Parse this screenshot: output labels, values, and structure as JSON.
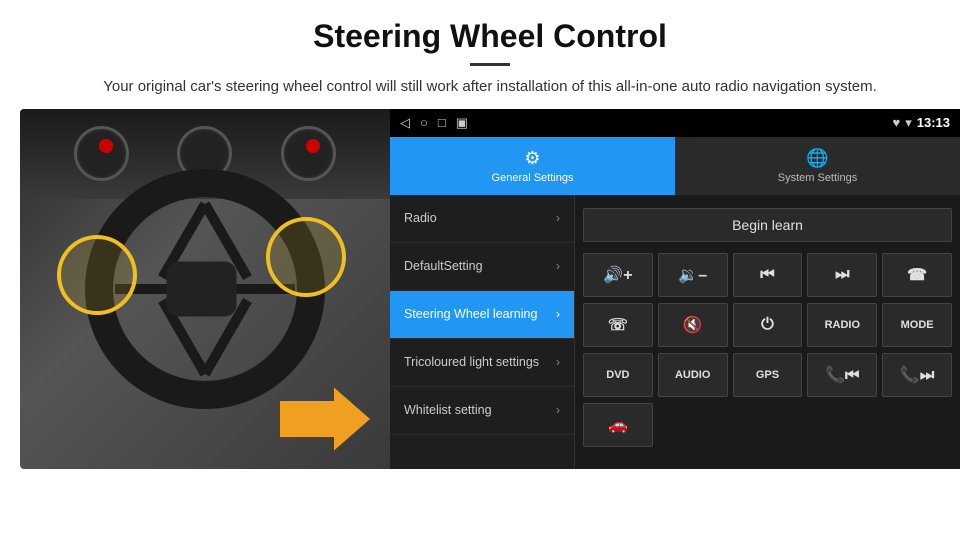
{
  "header": {
    "title": "Steering Wheel Control",
    "subtitle": "Your original car's steering wheel control will still work after installation of this all-in-one auto radio navigation system."
  },
  "status_bar": {
    "icons": [
      "◁",
      "○",
      "□",
      "▣"
    ],
    "right_icons": [
      "♥",
      "▾"
    ],
    "time": "13:13"
  },
  "tabs": [
    {
      "id": "general",
      "label": "General Settings",
      "icon": "⚙",
      "active": true
    },
    {
      "id": "system",
      "label": "System Settings",
      "icon": "🌐",
      "active": false
    }
  ],
  "menu_items": [
    {
      "id": "radio",
      "label": "Radio",
      "active": false
    },
    {
      "id": "default-setting",
      "label": "DefaultSetting",
      "active": false
    },
    {
      "id": "steering-wheel",
      "label": "Steering Wheel learning",
      "active": true
    },
    {
      "id": "tricoloured",
      "label": "Tricoloured light settings",
      "active": false
    },
    {
      "id": "whitelist",
      "label": "Whitelist setting",
      "active": false
    }
  ],
  "control_panel": {
    "begin_learn_label": "Begin learn",
    "buttons_row1": [
      {
        "id": "vol-up",
        "symbol": "🔊+",
        "label": "vol-up"
      },
      {
        "id": "vol-down",
        "symbol": "🔈-",
        "label": "vol-down"
      },
      {
        "id": "prev-track",
        "symbol": "⏮",
        "label": "prev-track"
      },
      {
        "id": "next-track",
        "symbol": "⏭",
        "label": "next-track"
      },
      {
        "id": "phone",
        "symbol": "☎",
        "label": "phone"
      }
    ],
    "buttons_row2": [
      {
        "id": "hang-up",
        "symbol": "☏",
        "label": "hang-up"
      },
      {
        "id": "mute",
        "symbol": "🔇",
        "label": "mute"
      },
      {
        "id": "power",
        "symbol": "⏻",
        "label": "power"
      },
      {
        "id": "radio-btn",
        "symbol": "RADIO",
        "label": "radio",
        "is_text": true
      },
      {
        "id": "mode-btn",
        "symbol": "MODE",
        "label": "mode",
        "is_text": true
      }
    ],
    "buttons_row3": [
      {
        "id": "dvd-btn",
        "symbol": "DVD",
        "label": "dvd",
        "is_text": true
      },
      {
        "id": "audio-btn",
        "symbol": "AUDIO",
        "label": "audio",
        "is_text": true
      },
      {
        "id": "gps-btn",
        "symbol": "GPS",
        "label": "gps",
        "is_text": true
      },
      {
        "id": "tel-prev",
        "symbol": "📞⏮",
        "label": "tel-prev"
      },
      {
        "id": "tel-next",
        "symbol": "📞⏭",
        "label": "tel-next"
      }
    ],
    "buttons_row4": [
      {
        "id": "extra-btn",
        "symbol": "🚗",
        "label": "extra"
      }
    ]
  }
}
